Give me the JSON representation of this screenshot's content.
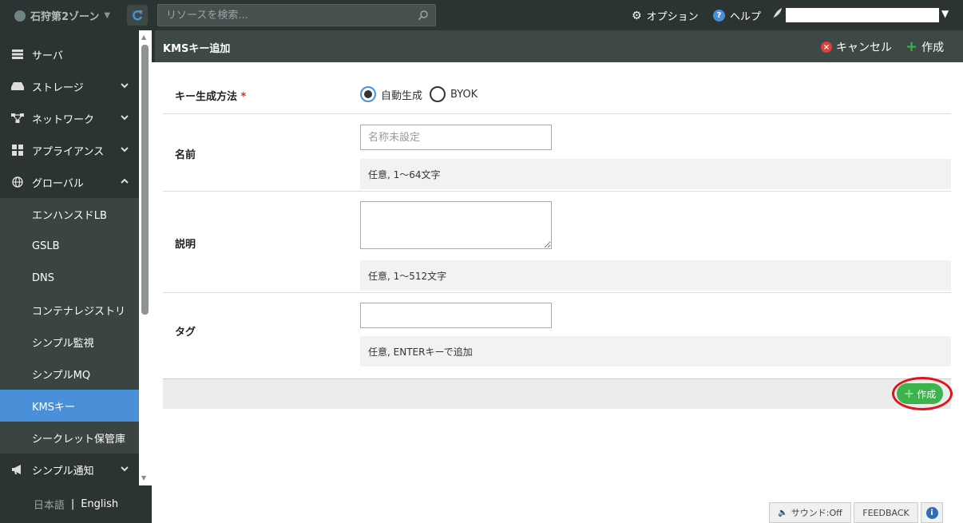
{
  "topbar": {
    "zone": "石狩第2ゾーン",
    "search_placeholder": "リソースを検索...",
    "option": "オプション",
    "help": "ヘルプ"
  },
  "sidebar": {
    "items": [
      {
        "label": "サーバ",
        "icon": "server-icon"
      },
      {
        "label": "ストレージ",
        "icon": "storage-icon"
      },
      {
        "label": "ネットワーク",
        "icon": "network-icon"
      },
      {
        "label": "アプライアンス",
        "icon": "appliance-icon"
      },
      {
        "label": "グローバル",
        "icon": "globe-icon"
      }
    ],
    "subitems": [
      "エンハンスドLB",
      "GSLB",
      "DNS",
      "コンテナレジストリ",
      "シンプル監視",
      "シンプルMQ",
      "KMSキー",
      "シークレット保管庫"
    ],
    "notify": "シンプル通知",
    "lang_ja": "日本語",
    "lang_sep": "|",
    "lang_en": "English"
  },
  "header": {
    "title": "KMSキー追加",
    "cancel": "キャンセル",
    "create": "作成"
  },
  "form": {
    "method_label": "キー生成方法",
    "required_mark": "*",
    "method_auto": "自動生成",
    "method_byok": "BYOK",
    "name_label": "名前",
    "name_placeholder": "名称未設定",
    "name_hint": "任意, 1〜64文字",
    "desc_label": "説明",
    "desc_hint": "任意, 1〜512文字",
    "tag_label": "タグ",
    "tag_hint": "任意, ENTERキーで追加",
    "create_button": "作成"
  },
  "bottom": {
    "sound": "サウンド:Off",
    "feedback": "FEEDBACK"
  },
  "colors": {
    "accent": "#4a90d9",
    "create": "#3cb44b",
    "highlight": "#e0151a"
  }
}
